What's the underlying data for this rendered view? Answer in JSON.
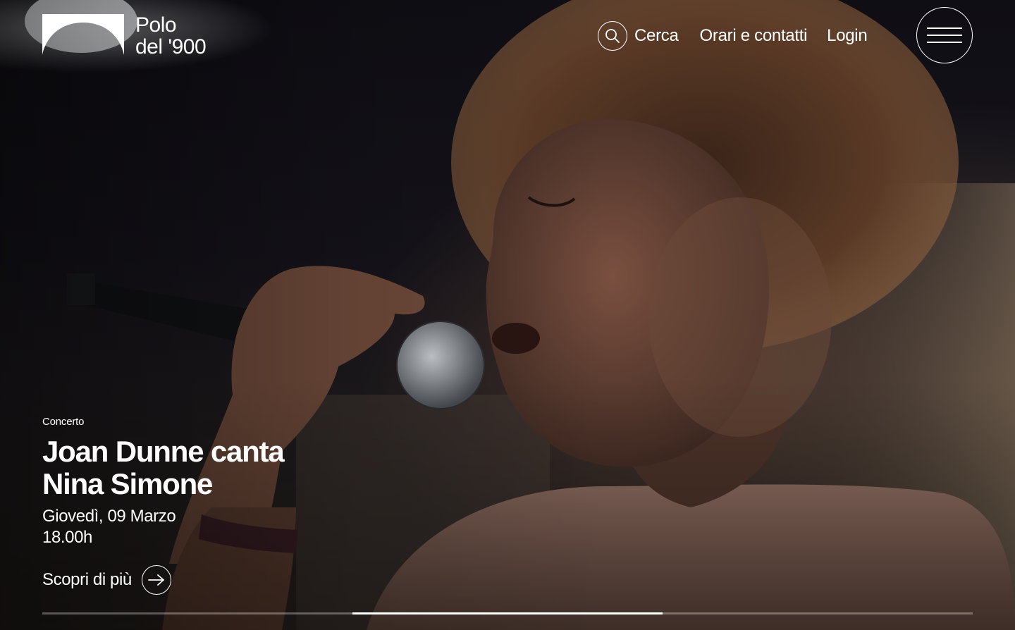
{
  "brand": {
    "line1": "Polo",
    "line2": "del '900"
  },
  "nav": {
    "search_label": "Cerca",
    "hours_label": "Orari e contatti",
    "login_label": "Login"
  },
  "slide": {
    "category": "Concerto",
    "title": "Joan Dunne canta Nina Simone",
    "date": "Giovedì, 09 Marzo",
    "time": "18.00h",
    "cta_label": "Scopri di più"
  },
  "carousel": {
    "slide_count": 3,
    "active_index": 1
  },
  "colors": {
    "text": "#ffffff",
    "background": "#0d0c10",
    "track": "#ffffff4d"
  },
  "icons": {
    "search": "search-icon",
    "menu": "hamburger-menu-icon",
    "arrow": "arrow-right-icon",
    "logo": "logo-mark-icon"
  }
}
